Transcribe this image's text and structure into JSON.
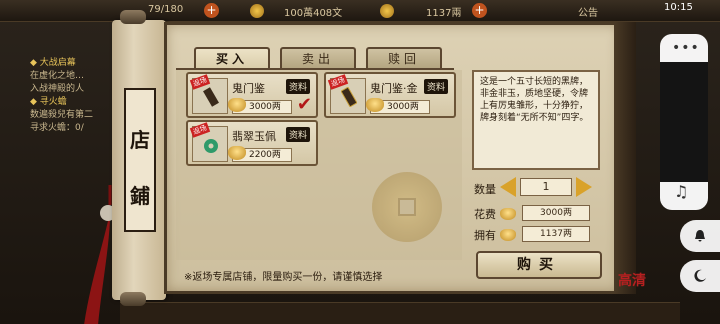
{
  "topbar": {
    "level_text": "79/180",
    "money_text": "100萬408文",
    "gold_text": "1137兩",
    "announce_label": "公告",
    "plus_label": "+"
  },
  "phone": {
    "time": "10:15",
    "menu_dots": "•••",
    "music_icon": "♫"
  },
  "quest": {
    "title1": "◆ 大战启幕",
    "line1": "在虚化之地…",
    "line2": "入战神殿的人",
    "title2": "◆ 寻火蟾",
    "line3": "数遍殺兒有第二",
    "line4": "寻求火蟾：0/"
  },
  "shop": {
    "title_char1": "店",
    "title_char2": "鋪",
    "tabs": [
      {
        "label": "买入"
      },
      {
        "label": "卖出"
      },
      {
        "label": "赎回"
      }
    ],
    "items": [
      {
        "name": "鬼门鉴",
        "badge": "资料",
        "price": "3000两",
        "tag": "返场",
        "selected": true
      },
      {
        "name": "鬼门鉴·金",
        "badge": "资料",
        "price": "3000两",
        "tag": "返场",
        "selected": false
      },
      {
        "name": "翡翠玉佩",
        "badge": "资料",
        "price": "2200两",
        "tag": "返场",
        "selected": false
      }
    ],
    "check_mark": "✔",
    "notice": "※返场专属店铺，限量购买一份，请谨慎选择",
    "description": "这是一个五寸长短的黑牌，非金非玉，质地坚硬，令牌上有厉鬼雏形，十分狰狞，牌身刻着“无所不知”四字。",
    "qty_label": "数量",
    "qty_value": "1",
    "cost_label": "花费",
    "cost_value": "3000两",
    "own_label": "拥有",
    "own_value": "1137两",
    "buy_label": "购买",
    "logo_text": "高清"
  },
  "colors": {
    "accent_red": "#b21818",
    "gold": "#d9a22a",
    "parchment": "#ddd1b4"
  }
}
